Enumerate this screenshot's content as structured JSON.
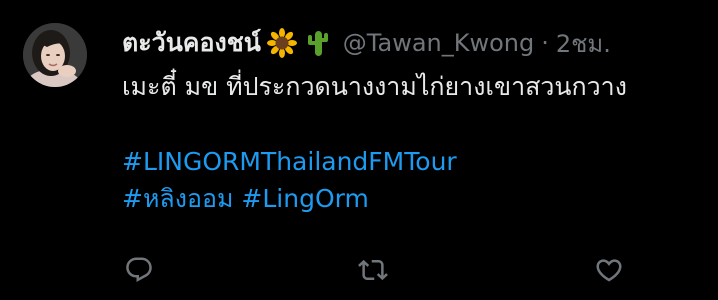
{
  "tweet": {
    "display_name": "ตะวันคองชน์",
    "emojis": [
      "sunflower-icon",
      "cactus-icon"
    ],
    "handle": "@Tawan_Kwong",
    "separator": "·",
    "time": "2ชม.",
    "text": "เมะตี๋ มข ที่ประกวดนางงามไก่ยางเขาสวนกวาง",
    "hashtags_line1": "#LINGORMThailandFMTour",
    "hashtags_line2": "#หลิงออม #LingOrm"
  },
  "actions": [
    {
      "name": "reply",
      "icon": "reply-icon"
    },
    {
      "name": "retweet",
      "icon": "retweet-icon"
    },
    {
      "name": "like",
      "icon": "like-icon"
    }
  ],
  "colors": {
    "background": "#000000",
    "text": "#e7e9ea",
    "muted": "#71767b",
    "link": "#1d9bf0"
  }
}
